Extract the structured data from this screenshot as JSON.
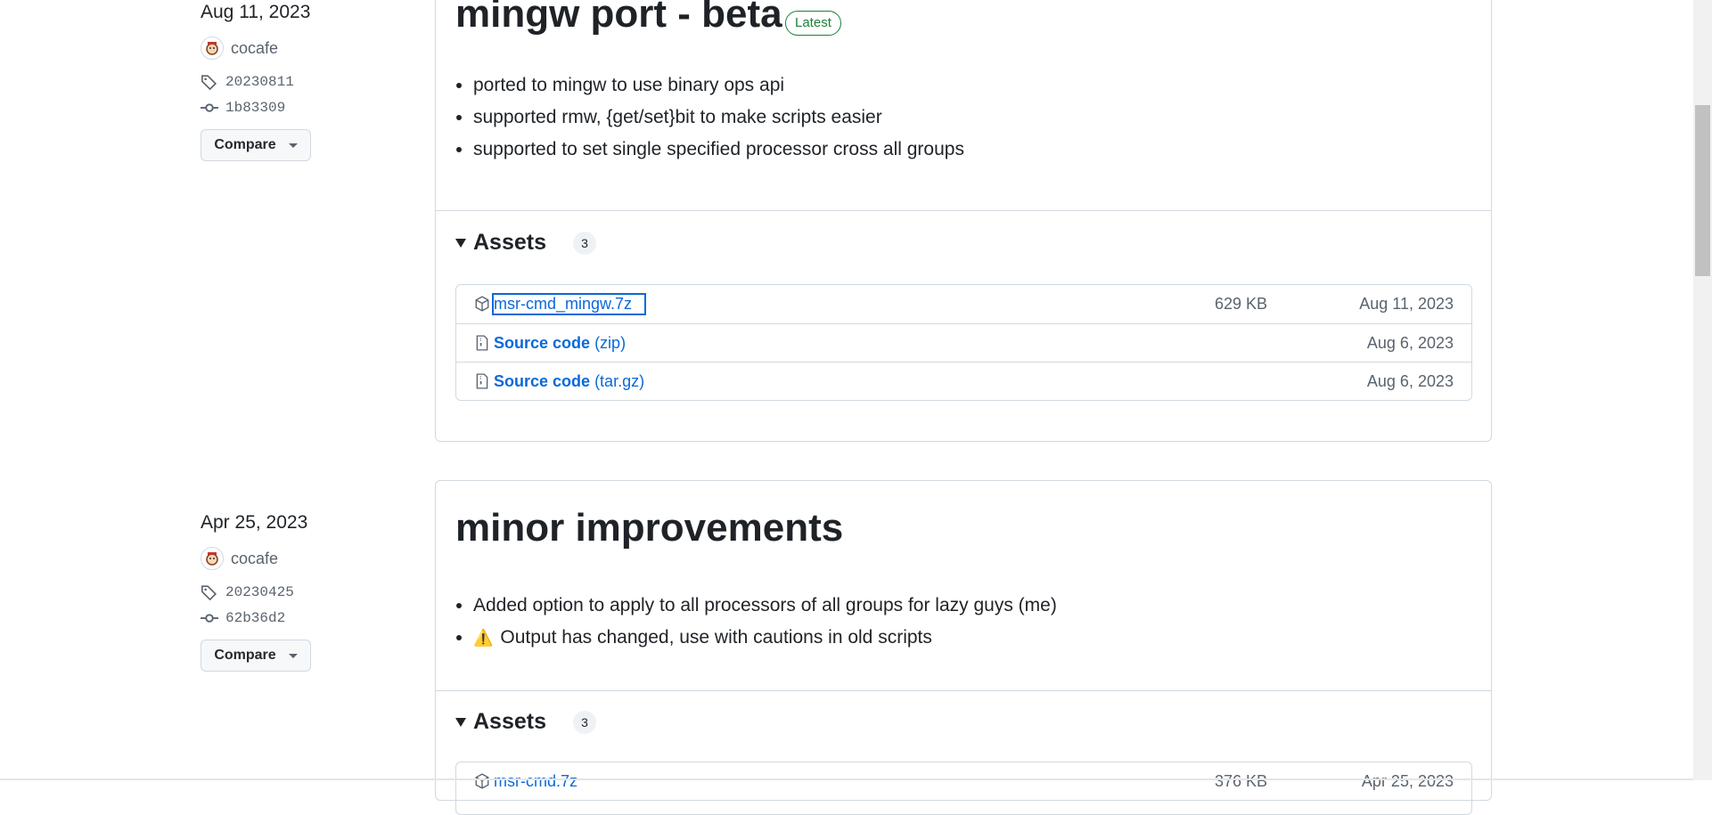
{
  "releases": [
    {
      "date": "Aug 11, 2023",
      "author": "cocafe",
      "tag": "20230811",
      "commit": "1b83309",
      "compare_label": "Compare",
      "title": "mingw port - beta",
      "badge": "Latest",
      "notes": [
        "ported to mingw to use binary ops api",
        "supported rmw, {get/set}bit to make scripts easier",
        "supported to set single specified processor cross all groups"
      ],
      "assets_label": "Assets",
      "assets_count": "3",
      "assets": [
        {
          "name": "msr-cmd_mingw.7z",
          "suffix": "",
          "size": "629 KB",
          "date": "Aug 11, 2023",
          "icon": "package-icon"
        },
        {
          "name": "Source code",
          "suffix": "(zip)",
          "size": "",
          "date": "Aug 6, 2023",
          "icon": "file-zip-icon"
        },
        {
          "name": "Source code",
          "suffix": "(tar.gz)",
          "size": "",
          "date": "Aug 6, 2023",
          "icon": "file-zip-icon"
        }
      ]
    },
    {
      "date": "Apr 25, 2023",
      "author": "cocafe",
      "tag": "20230425",
      "commit": "62b36d2",
      "compare_label": "Compare",
      "title": "minor improvements",
      "notes": [
        "Added option to apply to all processors of all groups for lazy guys (me)",
        "Output has changed, use with cautions in old scripts"
      ],
      "warning_icon": "⚠️",
      "assets_label": "Assets",
      "assets_count": "3",
      "assets_partial": {
        "name": "msr-cmd.7z",
        "size": "376 KB",
        "date": "Apr 25, 2023"
      }
    }
  ],
  "colors": {
    "link": "#0969da",
    "latest": "#1a7f37",
    "muted": "#59636e",
    "border": "#d1d9e0"
  }
}
